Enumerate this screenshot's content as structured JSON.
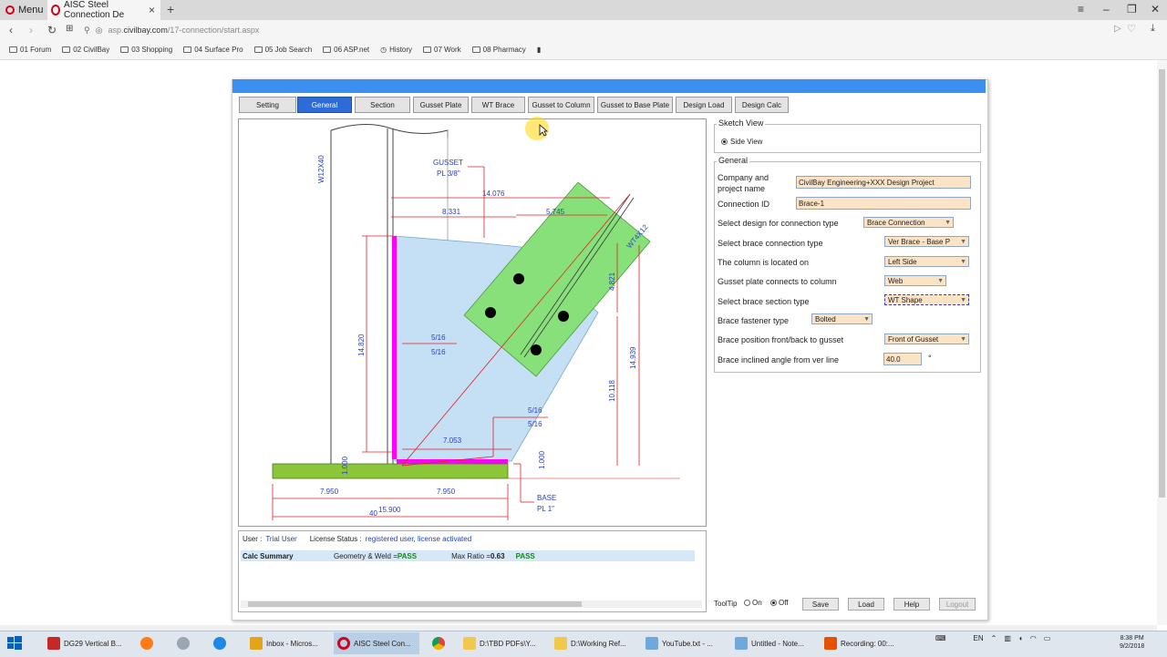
{
  "browser": {
    "menu_label": "Menu",
    "tab_title": "AISC Steel Connection De",
    "url_prefix": "asp.",
    "url_host": "civilbay.com",
    "url_path": "/17-connection/start.aspx",
    "bookmarks": [
      "01 Forum",
      "02 CivilBay",
      "03 Shopping",
      "04 Surface Pro",
      "05 Job Search",
      "06 ASP.net",
      "History",
      "07 Work",
      "08 Pharmacy"
    ]
  },
  "app": {
    "tabs": [
      "Setting",
      "General",
      "Section",
      "Gusset Plate",
      "WT Brace",
      "Gusset to Column",
      "Gusset to Base Plate",
      "Design Load",
      "Design Calc"
    ],
    "active_tab": "General",
    "sketch": {
      "column_label": "W12X40",
      "brace_label": "WT4X12",
      "gusset_label_1": "GUSSET",
      "gusset_label_2": "PL 3/8\"",
      "base_label_1": "BASE",
      "base_label_2": "PL 1\"",
      "dims": {
        "d14076": "14.076",
        "d8331": "8.331",
        "d5745": "5.745",
        "d4821": "4.821",
        "d14820": "14.820",
        "d14939": "14.939",
        "d10118": "10.118",
        "d7053": "7.053",
        "d1000a": "1.000",
        "d1000b": "1.000",
        "d7950a": "7.950",
        "d7950b": "7.950",
        "d5900": "15.900",
        "d40": "40",
        "weld1a": "5/16",
        "weld1b": "5/16",
        "weld2a": "5/16",
        "weld2b": "5/16"
      }
    },
    "status": {
      "user_label": "User :",
      "user_value": "Trial User",
      "license_label": "License Status :",
      "license_value": "registered user, license activated",
      "summary_label": "Calc Summary",
      "geom_label": "Geometry & Weld = ",
      "geom_value": "PASS",
      "ratio_label": "Max Ratio = ",
      "ratio_value": "0.63",
      "ratio_status": "PASS"
    },
    "sketch_view": {
      "legend": "Sketch View",
      "option": "Side View"
    },
    "general": {
      "legend": "General",
      "company_label_1": "Company and",
      "company_label_2": "project name",
      "company_value": "CivilBay Engineering+XXX Design Project",
      "connection_id_label": "Connection ID",
      "connection_id_value": "Brace-1",
      "design_type_label": "Select design for connection type",
      "design_type_value": "Brace Connection",
      "brace_conn_label": "Select brace connection type",
      "brace_conn_value": "Ver Brace - Base P",
      "column_loc_label": "The column is located on",
      "column_loc_value": "Left Side",
      "gusset_conn_label": "Gusset plate connects to column",
      "gusset_conn_value": "Web",
      "brace_section_label": "Select brace section type",
      "brace_section_value": "WT Shape",
      "fastener_label": "Brace fastener type",
      "fastener_value": "Bolted",
      "position_label": "Brace position front/back to gusset",
      "position_value": "Front of Gusset",
      "angle_label": "Brace inclined angle from ver line",
      "angle_value": "40.0",
      "angle_unit": "°"
    },
    "footer": {
      "tooltip_label": "ToolTip",
      "on_label": "On",
      "off_label": "Off",
      "save": "Save",
      "load": "Load",
      "help": "Help",
      "logout": "Logout"
    }
  },
  "taskbar": {
    "items": [
      "DG29 Vertical B...",
      "",
      "",
      "",
      "Inbox - Micros...",
      "AISC Steel Con...",
      "",
      "D:\\TBD PDFs\\Y...",
      "D:\\Working Ref...",
      "YouTube.txt - ...",
      "Untitled - Note...",
      "Recording: 00:..."
    ],
    "lang": "EN",
    "time": "8:38 PM",
    "date": "9/2/2018"
  },
  "colors": {
    "tab_active": "#2f6bd6",
    "title_bar": "#3b8ff0",
    "input_bg": "#fbe3c5",
    "pass": "#138a13",
    "gusset": "#c5dff5",
    "brace": "#88e07a",
    "weld": "#ff00ff",
    "base_plate": "#8ac53a",
    "dimension": "#e02020",
    "label_blue": "#2b3fbf"
  }
}
